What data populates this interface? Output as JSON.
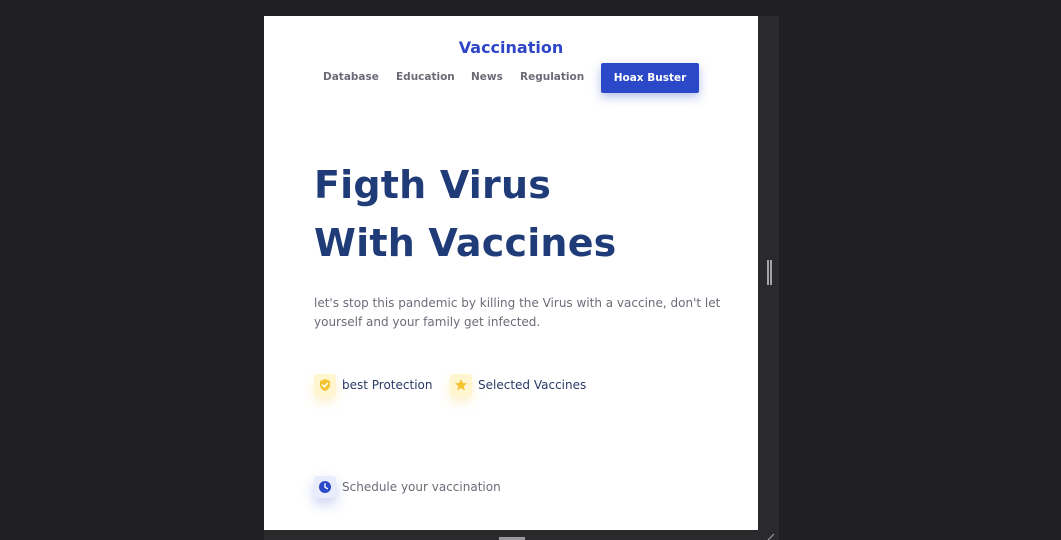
{
  "brand": "Vaccination",
  "nav": {
    "items": [
      "Database",
      "Education",
      "News",
      "Regulation"
    ],
    "cta": "Hoax Buster"
  },
  "hero": {
    "title_line1": "Figth Virus",
    "title_line2": "With Vaccines",
    "description": "let's stop this pandemic by killing the Virus with a vaccine, don't let yourself and your family get infected."
  },
  "features": [
    {
      "label": "best Protection",
      "icon": "shield-check-icon"
    },
    {
      "label": "Selected Vaccines",
      "icon": "star-icon"
    }
  ],
  "schedule": {
    "label": "Schedule your vaccination",
    "icon": "clock-icon"
  },
  "colors": {
    "accent": "#2b48c9",
    "title": "#1f3b78",
    "feature_icon": "#f4c430"
  }
}
